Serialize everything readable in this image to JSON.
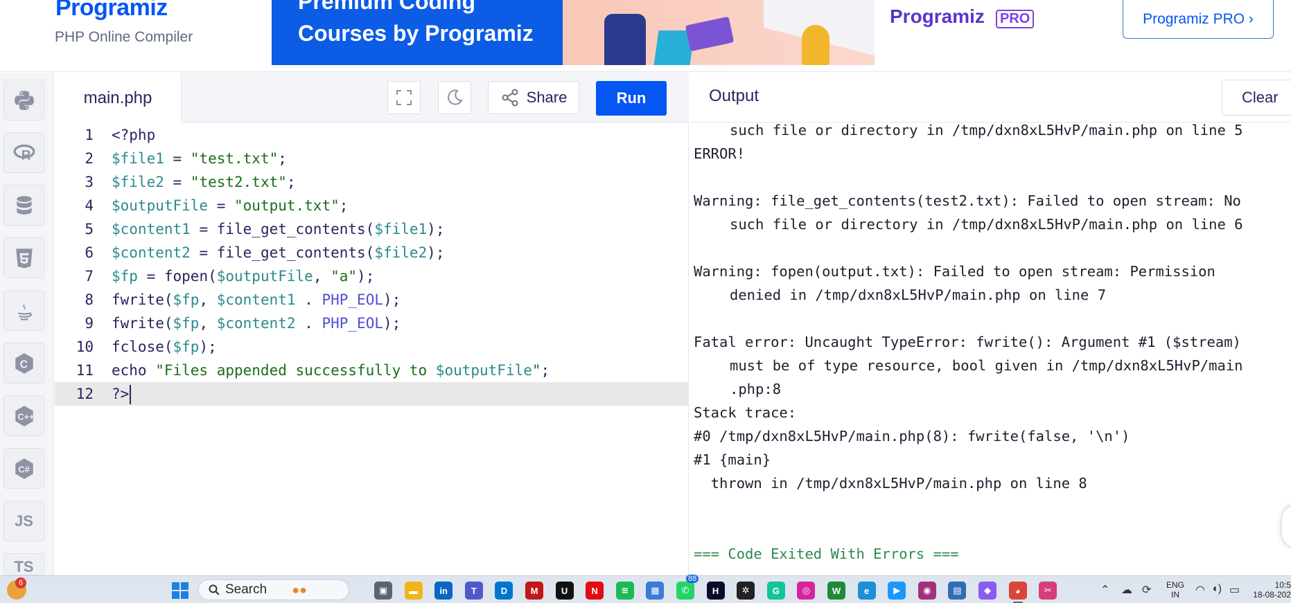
{
  "header": {
    "logo_text": "Programiz",
    "subtitle": "PHP Online Compiler",
    "banner_line1": "Premium Coding",
    "banner_line2": "Courses by Programiz",
    "banner_brand": "Programiz",
    "banner_pro_tag": "PRO",
    "pro_button": "Programiz PRO ›"
  },
  "rail": {
    "items": [
      {
        "icon": "python-icon"
      },
      {
        "icon": "r-icon"
      },
      {
        "icon": "sql-database-icon"
      },
      {
        "icon": "html5-icon"
      },
      {
        "icon": "java-icon"
      },
      {
        "icon": "c-icon"
      },
      {
        "icon": "cpp-icon"
      },
      {
        "icon": "csharp-icon"
      },
      {
        "icon": "js-icon",
        "label": "JS"
      },
      {
        "icon": "ts-icon",
        "label": "TS"
      }
    ]
  },
  "editor": {
    "file_tab": "main.php",
    "share_label": "Share",
    "run_label": "Run",
    "active_line": 12,
    "lines": [
      {
        "n": "1",
        "tokens": [
          {
            "t": "plain",
            "v": "<?php"
          }
        ]
      },
      {
        "n": "2",
        "tokens": [
          {
            "t": "var",
            "v": "$file1"
          },
          {
            "t": "plain",
            "v": " = "
          },
          {
            "t": "str",
            "v": "\"test.txt\""
          },
          {
            "t": "plain",
            "v": ";"
          }
        ]
      },
      {
        "n": "3",
        "tokens": [
          {
            "t": "var",
            "v": "$file2"
          },
          {
            "t": "plain",
            "v": " = "
          },
          {
            "t": "str",
            "v": "\"test2.txt\""
          },
          {
            "t": "plain",
            "v": ";"
          }
        ]
      },
      {
        "n": "4",
        "tokens": [
          {
            "t": "var",
            "v": "$outputFile"
          },
          {
            "t": "plain",
            "v": " = "
          },
          {
            "t": "str",
            "v": "\"output.txt\""
          },
          {
            "t": "plain",
            "v": ";"
          }
        ]
      },
      {
        "n": "5",
        "tokens": [
          {
            "t": "var",
            "v": "$content1"
          },
          {
            "t": "plain",
            "v": " = file_get_contents("
          },
          {
            "t": "var",
            "v": "$file1"
          },
          {
            "t": "plain",
            "v": ");"
          }
        ]
      },
      {
        "n": "6",
        "tokens": [
          {
            "t": "var",
            "v": "$content2"
          },
          {
            "t": "plain",
            "v": " = file_get_contents("
          },
          {
            "t": "var",
            "v": "$file2"
          },
          {
            "t": "plain",
            "v": ");"
          }
        ]
      },
      {
        "n": "7",
        "tokens": [
          {
            "t": "var",
            "v": "$fp"
          },
          {
            "t": "plain",
            "v": " = fopen("
          },
          {
            "t": "var",
            "v": "$outputFile"
          },
          {
            "t": "plain",
            "v": ", "
          },
          {
            "t": "str",
            "v": "\"a\""
          },
          {
            "t": "plain",
            "v": ");"
          }
        ]
      },
      {
        "n": "8",
        "tokens": [
          {
            "t": "plain",
            "v": "fwrite("
          },
          {
            "t": "var",
            "v": "$fp"
          },
          {
            "t": "plain",
            "v": ", "
          },
          {
            "t": "var",
            "v": "$content1"
          },
          {
            "t": "plain",
            "v": " . "
          },
          {
            "t": "const",
            "v": "PHP_EOL"
          },
          {
            "t": "plain",
            "v": ");"
          }
        ]
      },
      {
        "n": "9",
        "tokens": [
          {
            "t": "plain",
            "v": "fwrite("
          },
          {
            "t": "var",
            "v": "$fp"
          },
          {
            "t": "plain",
            "v": ", "
          },
          {
            "t": "var",
            "v": "$content2"
          },
          {
            "t": "plain",
            "v": " . "
          },
          {
            "t": "const",
            "v": "PHP_EOL"
          },
          {
            "t": "plain",
            "v": ");"
          }
        ]
      },
      {
        "n": "10",
        "tokens": [
          {
            "t": "plain",
            "v": "fclose("
          },
          {
            "t": "var",
            "v": "$fp"
          },
          {
            "t": "plain",
            "v": ");"
          }
        ]
      },
      {
        "n": "11",
        "tokens": [
          {
            "t": "plain",
            "v": "echo "
          },
          {
            "t": "str",
            "v": "\"Files appended successfully to "
          },
          {
            "t": "var",
            "v": "$outputFile"
          },
          {
            "t": "str",
            "v": "\""
          },
          {
            "t": "plain",
            "v": ";"
          }
        ]
      },
      {
        "n": "12",
        "tokens": [
          {
            "t": "plain",
            "v": "?>"
          }
        ]
      }
    ]
  },
  "output": {
    "title": "Output",
    "clear_label": "Clear",
    "lines": [
      {
        "text": "such file or directory in /tmp/dxn8xL5HvP/main.php on line 5",
        "indent": true
      },
      {
        "text": "ERROR!"
      },
      {
        "text": ""
      },
      {
        "text": "Warning: file_get_contents(test2.txt): Failed to open stream: No"
      },
      {
        "text": "such file or directory in /tmp/dxn8xL5HvP/main.php on line 6",
        "indent": true
      },
      {
        "text": ""
      },
      {
        "text": "Warning: fopen(output.txt): Failed to open stream: Permission"
      },
      {
        "text": "denied in /tmp/dxn8xL5HvP/main.php on line 7",
        "indent": true
      },
      {
        "text": ""
      },
      {
        "text": "Fatal error: Uncaught TypeError: fwrite(): Argument #1 ($stream)"
      },
      {
        "text": "must be of type resource, bool given in /tmp/dxn8xL5HvP/main",
        "indent": true
      },
      {
        "text": ".php:8",
        "indent": true
      },
      {
        "text": "Stack trace:"
      },
      {
        "text": "#0 /tmp/dxn8xL5HvP/main.php(8): fwrite(false, '\\n')"
      },
      {
        "text": "#1 {main}"
      },
      {
        "text": "  thrown in /tmp/dxn8xL5HvP/main.php on line 8"
      },
      {
        "text": ""
      },
      {
        "text": ""
      },
      {
        "text": "=== Code Exited With Errors ===",
        "exit": true
      }
    ]
  },
  "taskbar": {
    "weather_badge": "6",
    "search_label": "Search",
    "whatsapp_badge": "88",
    "lang_line1": "ENG",
    "lang_line2": "IN",
    "time": "10:5",
    "date": "18-08-202",
    "apps": [
      {
        "name": "task-view-icon",
        "color": "#5c6370",
        "glyph": "▣"
      },
      {
        "name": "file-explorer-icon",
        "color": "#f2b418",
        "glyph": "▬"
      },
      {
        "name": "linkedin-icon",
        "color": "#0a66c2",
        "glyph": "in"
      },
      {
        "name": "teams-icon",
        "color": "#5059c9",
        "glyph": "T"
      },
      {
        "name": "dell-icon",
        "color": "#0076ce",
        "glyph": "D"
      },
      {
        "name": "mcafee-icon",
        "color": "#c01818",
        "glyph": "M"
      },
      {
        "name": "uber-icon",
        "color": "#111111",
        "glyph": "U"
      },
      {
        "name": "netflix-icon",
        "color": "#e50914",
        "glyph": "N"
      },
      {
        "name": "spotify-icon",
        "color": "#1db954",
        "glyph": "≋"
      },
      {
        "name": "store-icon",
        "color": "#3a7bd5",
        "glyph": "▦"
      },
      {
        "name": "whatsapp-icon",
        "color": "#25d366",
        "glyph": "✆"
      },
      {
        "name": "hotstar-icon",
        "color": "#0b0b2b",
        "glyph": "H"
      },
      {
        "name": "chatgpt-icon",
        "color": "#222222",
        "glyph": "✲"
      },
      {
        "name": "grammarly-icon",
        "color": "#15c39a",
        "glyph": "G"
      },
      {
        "name": "instagram-icon",
        "color": "#d6249f",
        "glyph": "◎"
      },
      {
        "name": "wordpress-icon",
        "color": "#1f8a3a",
        "glyph": "W"
      },
      {
        "name": "edge-icon",
        "color": "#1c8fd6",
        "glyph": "e"
      },
      {
        "name": "prime-video-icon",
        "color": "#1a98ff",
        "glyph": "▶"
      },
      {
        "name": "media-player-icon",
        "color": "#a1327a",
        "glyph": "◉"
      },
      {
        "name": "notepad-icon",
        "color": "#2f6db5",
        "glyph": "▤"
      },
      {
        "name": "copilot-icon",
        "color": "#8a5cf0",
        "glyph": "◆"
      },
      {
        "name": "chrome-icon",
        "color": "#db4437",
        "glyph": "◕",
        "active": true
      },
      {
        "name": "snipping-tool-icon",
        "color": "#d43f7a",
        "glyph": "✂"
      }
    ]
  }
}
